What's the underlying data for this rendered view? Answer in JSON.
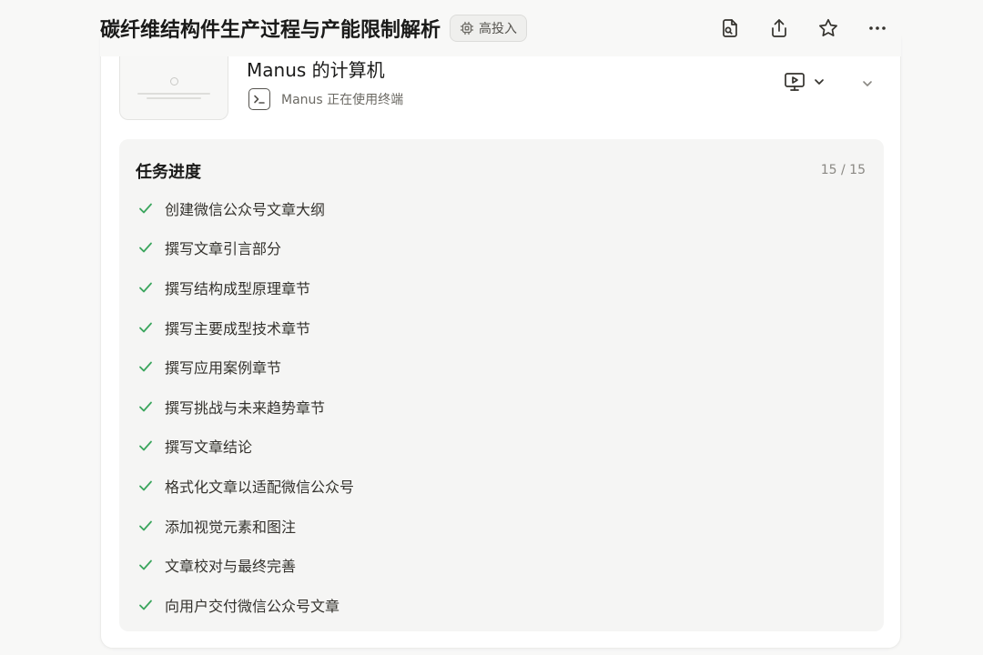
{
  "header": {
    "title": "碳纤维结构件生产过程与产能限制解析",
    "badge": "高投入",
    "actions": [
      "file-search-icon",
      "share-icon",
      "star-icon",
      "more-icon"
    ]
  },
  "computer": {
    "title": "Manus 的计算机",
    "status": "Manus 正在使用终端"
  },
  "progress": {
    "title": "任务进度",
    "count": "15 / 15",
    "tasks": [
      "创建微信公众号文章大纲",
      "撰写文章引言部分",
      "撰写结构成型原理章节",
      "撰写主要成型技术章节",
      "撰写应用案例章节",
      "撰写挑战与未来趋势章节",
      "撰写文章结论",
      "格式化文章以适配微信公众号",
      "添加视觉元素和图注",
      "文章校对与最终完善",
      "向用户交付微信公众号文章"
    ]
  },
  "colors": {
    "check": "#3aa55d",
    "text": "#34322d",
    "muted": "#8a8883"
  }
}
